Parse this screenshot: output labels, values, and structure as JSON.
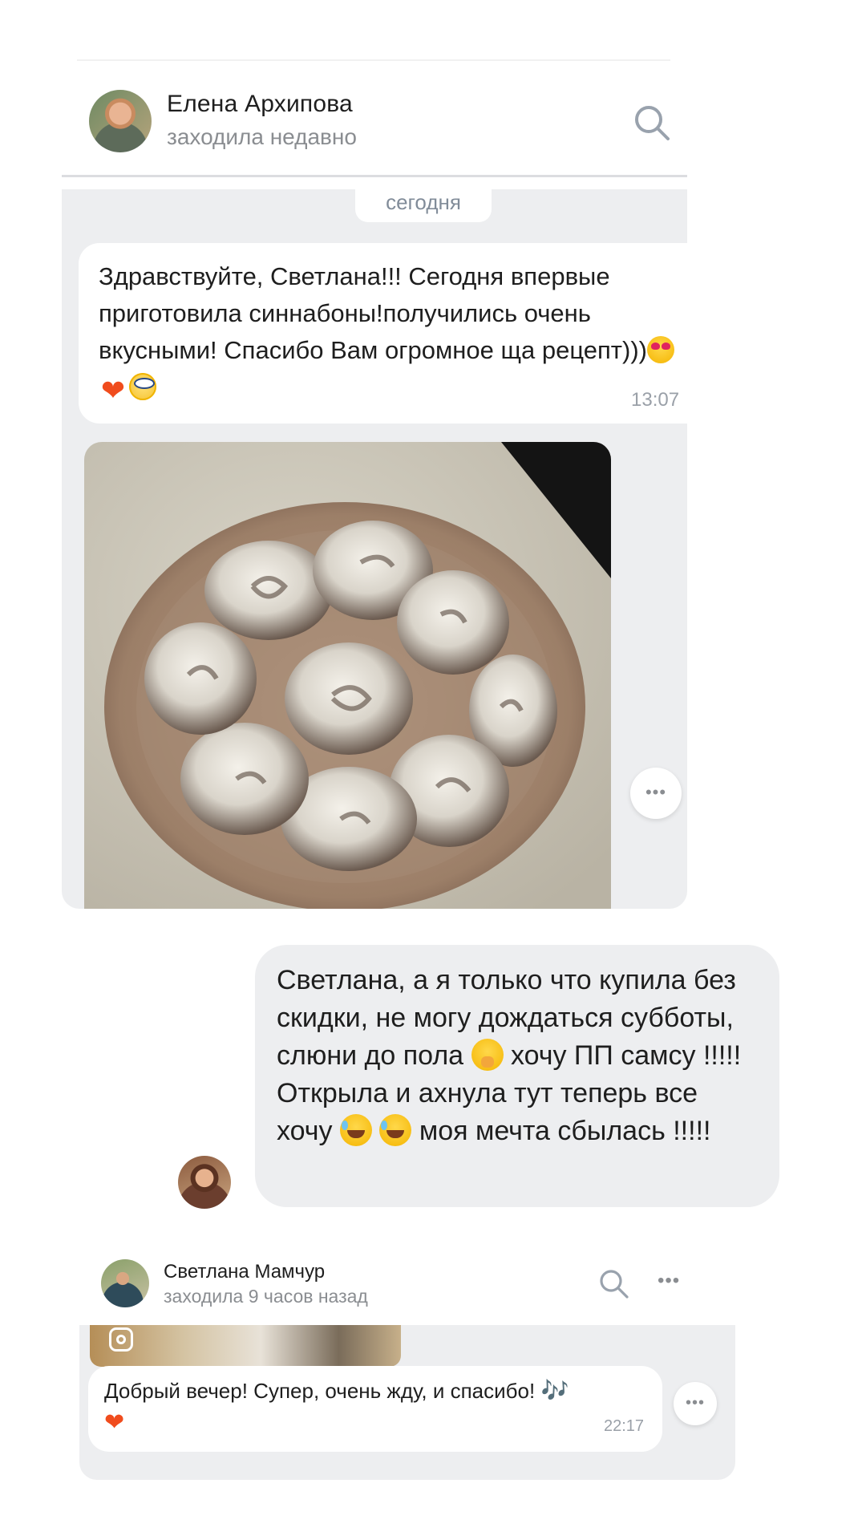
{
  "chat1": {
    "contact_name": "Елена Архипова",
    "contact_status": "заходила недавно",
    "date_separator": "сегодня",
    "message": {
      "text": "Здравствуйте, Светлана!!! Сегодня впервые приготовила синнабоны!получились очень вкусными! Спасибо Вам огромное ща рецепт)))",
      "emojis": [
        "smiling-face-with-heart-eyes",
        "red-heart",
        "face-with-rolling-eyes"
      ],
      "time": "13:07"
    },
    "photo": {
      "subject": "cinnamon-rolls-plate"
    },
    "more_button": "•••"
  },
  "outgoing": {
    "segments": [
      "Светлана, а я только что купила без скидки, не могу дождаться субботы, слюни до пола ",
      " хочу ПП самсу !!!!! Открыла и ахнула тут теперь все хочу ",
      " моя мечта сбылась !!!!!"
    ],
    "emojis": [
      "face-with-hand-over-mouth",
      "rolling-on-the-floor-laughing",
      "rolling-on-the-floor-laughing"
    ]
  },
  "chat2": {
    "contact_name": "Светлана Мамчур",
    "contact_status": "заходила 9 часов назад",
    "message": {
      "text": "Добрый вечер! Супер, очень жду, и спасибо! ",
      "emojis": [
        "musical-notes",
        "orange-heart"
      ],
      "notes_glyph": "🎶",
      "heart_glyph": "❤",
      "time": "22:17"
    },
    "more_button": "•••"
  },
  "colors": {
    "bubble_gray": "#edeef0",
    "meta_gray": "#8a8d91",
    "heart": "#f04c1d"
  }
}
